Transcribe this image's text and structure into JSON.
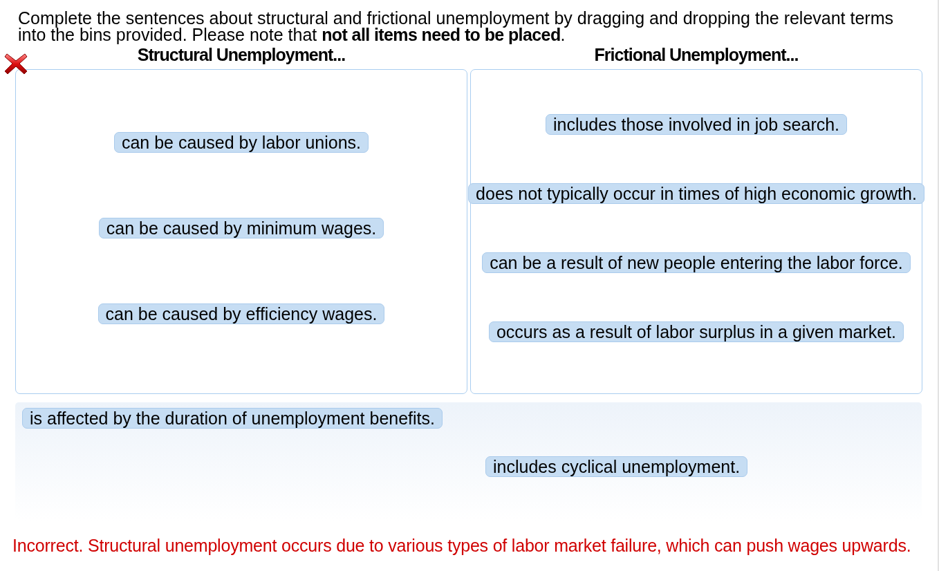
{
  "instructions": "Complete the sentences about structural and frictional unemployment by dragging and dropping the relevant terms into the bins provided. Please note that **not all items need to be placed**.",
  "correct": false,
  "bins": [
    {
      "title": "Structural Unemployment...",
      "items": [
        "can be caused by labor unions.",
        "can be caused by minimum wages.",
        "can be caused by efficiency wages."
      ]
    },
    {
      "title": "Frictional Unemployment...",
      "items": [
        "includes those involved in job search.",
        "does not typically occur in times of high economic growth.",
        "can be a result of new people entering the labor force.",
        "occurs as a result of labor surplus in a given market."
      ]
    }
  ],
  "unplaced": [
    "is affected by the duration of unemployment benefits.",
    "includes cyclical unemployment."
  ],
  "feedback": "Incorrect. Structural unemployment occurs due to various types of labor market failure, which can push wages upwards."
}
